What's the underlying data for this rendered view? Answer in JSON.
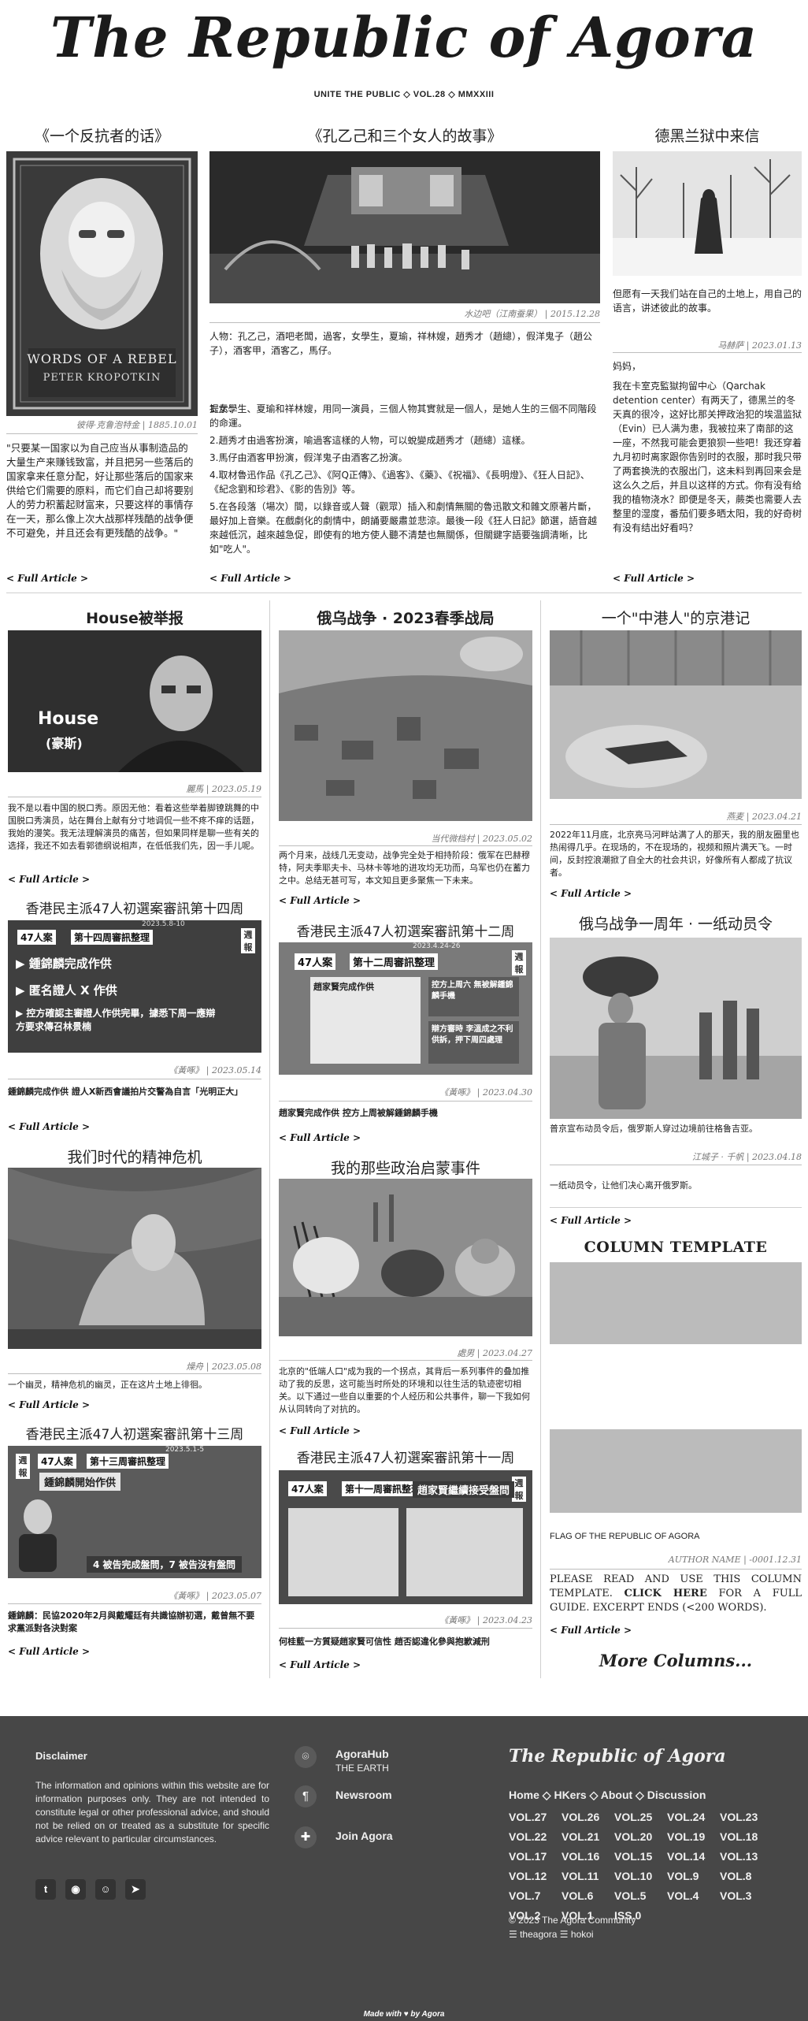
{
  "masthead": {
    "title": "The Republic of Agora",
    "subtitle": "UNITE THE PUBLIC ◇ VOL.28 ◇ MMXXIII"
  },
  "row1": {
    "a1": {
      "title": "《一个反抗者的话》",
      "book_words": "Words of a Rebel",
      "book_author": "Peter Kropotkin",
      "credit": "彼得·克鲁泡特金 | 1885.10.01",
      "text": "\"只要某一国家以为自己应当从事制造品的大量生产来赚钱致富，并且把另一些落后的国家拿来任意分配，好让那些落后的国家来供给它们需要的原料，而它们自己却将要别人的劳力积蓄起财富来，只要这样的事情存在一天，那么像上次大战那样残酷的战争便不可避免，并且还会有更残酷的战争。\"",
      "full": "< Full Article >"
    },
    "a2": {
      "title": "《孔乙己和三个女人的故事》",
      "credit": "水边吧（江南蚕果） | 2015.12.28",
      "intro": "人物：孔乙己，酒吧老闆，過客，女學生，夏瑜，祥林嫂，趙秀才（趙總），假洋鬼子（趙公子），酒客甲，酒客乙，馬仔。",
      "hint": "提示：",
      "items": [
        "1.女學生、夏瑜和祥林嫂，用同一演員，三個人物其實就是一個人，是她人生的三個不同階段的命運。",
        "2.趙秀才由過客扮演，喻過客這樣的人物，可以蛻變成趙秀才（趙總）這樣。",
        "3.馬仔由酒客甲扮演，假洋鬼子由酒客乙扮演。",
        "4.取材魯迅作品《孔乙己》、《阿Q正傳》、《過客》、《藥》、《祝福》、《長明燈》、《狂人日記》、《紀念劉和珍君》、《影的告別》等。",
        "5.在各段落（場次）間，以錄音或人聲（觀眾）插入和劇情無關的魯迅散文和雜文原著片斷，最好加上音樂。在戲劇化的劇情中，朗誦要嚴肅並悲涼。最後一段《狂人日記》節選，語音越來越低沉，越來越急促，即使有的地方使人聽不清楚也無關係，但關鍵字語要強調清晰，比如\"吃人\"。"
      ],
      "full": "< Full Article >"
    },
    "a3": {
      "title": "德黑兰狱中来信",
      "lead": "但愿有一天我们站在自己的土地上，用自己的语言，讲述彼此的故事。",
      "credit": "马赫萨 | 2023.01.13",
      "greeting": "妈妈，",
      "text": "我在卡室克監獄拘留中心（Qarchak detention center）有两天了，德黑兰的冬天真的很冷，这好比那关押政治犯的埃温监狱（Evin）已人满为患，我被拉来了南部的这一座，不然我可能会更狼狈一些吧！我还穿着九月初时离家跟你告别时的衣服，那时我只带了两套换洗的衣服出门，这未料到再回来会是这么久之后，并且以这样的方式。你有没有给我的植物浇水？即便是冬天，蕨类也需要人去整里的湿度，番茄们要多晒太阳，我的好奇树有没有结出好看吗？",
      "full": "< Full Article >"
    }
  },
  "rows": {
    "l1": {
      "title": "House被举报",
      "credit": "麗馬 | 2023.05.19",
      "text": "我不是以看中国的脱口秀。原因无他：看着这些举着脚镣跳舞的中国脱口秀演员，站在舞台上献有分寸地调侃一些不疼不痒的话题，我始的漫笑。我无法理解演员的痛苦，但如果同样是聊一些有关的选择，我还不如去看郭德纲说相声，在低低我们先，因一手儿呢。",
      "full": "< Full Article >",
      "img_caption": "House",
      "img_caption2": "(豪斯)"
    },
    "m1": {
      "title": "俄乌战争 · 2023春季战局",
      "credit": "当代微档村 | 2023.05.02",
      "text": "两个月来，战线几无变动，战争完全处于相持阶段：俄军在巴赫穆特，阿夫季耶夫卡、马林卡等地的进攻均无功而，乌军也仍在蓄力之中。总结无甚可写，本文知且更多聚焦一下未来。",
      "full": "< Full Article >"
    },
    "r1": {
      "title": "一个\"中港人\"的京港记",
      "credit": "燕麦 | 2023.04.21",
      "text": "2022年11月底，北京亮马河畔站满了人的那天，我的朋友圈里也热闹得几乎。在现场的，不在现场的，视频和照片满天飞。一时间，反封控浪潮掀了自全大的社会共识，好像所有人都成了抗议者。",
      "full": "< Full Article >"
    },
    "l2": {
      "title": "香港民主派47人初選案審訊第十四周",
      "credit": "《黃啄》 | 2023.05.14",
      "text": "鍾錦麟完成作供 證人X新西會議拍片交警為自言「光明正大」",
      "full": "< Full Article >",
      "card_case": "47人案",
      "card_week": "第十四周審訊整理",
      "card_date": "2023.5.8-10",
      "card_b1": "▶ 鍾錦麟完成作供",
      "card_b2": "▶ 匿名證人 X 作供",
      "card_b3": "▶ 控方確認主審證人作供完畢，據悉下周一應辯方要求傳召林景楠",
      "card_tag": "週報"
    },
    "m2": {
      "title": "香港民主派47人初選案審訊第十二周",
      "credit": "《黃啄》 | 2023.04.30",
      "text": "趙家賢完成作供 控方上周被解鍾錦麟手機",
      "full": "< Full Article >",
      "card_case": "47人案",
      "card_week": "第十二周審訊整理",
      "card_date": "2023.4.24-26",
      "card_box1": "趙家賢完成作供",
      "card_box2": "控方上周六 無被解鍾錦麟手機",
      "card_box3": "辯方審時 李溫成之不利供訴，押下周四處理",
      "card_tag": "週報"
    },
    "r2": {
      "title": "俄乌战争一周年 · 一纸动员令",
      "caption": "普京宣布动员令后，俄罗斯人穿过边境前往格鲁吉亚。",
      "credit": "江城子 · 千帆 | 2023.04.18",
      "text": "一纸动员令，让他们决心离开俄罗斯。",
      "full": "< Full Article >"
    },
    "l3": {
      "title": "我们时代的精神危机",
      "credit": "燥舟 | 2023.05.08",
      "text": "一个幽灵，精神危机的幽灵，正在这片土地上徘徊。",
      "full": "< Full Article >"
    },
    "m3": {
      "title": "我的那些政治启蒙事件",
      "credit": "處男 | 2023.04.27",
      "text": "北京的\"低端人口\"成为我的一个拐点，其背后一系列事件的叠加推动了我的反思，这可能当时所处的环境和以往生活的轨迹密切相关。以下通过一些自以重要的个人经历和公共事件，聊一下我如何从认同转向了对抗的。",
      "full": "< Full Article >"
    },
    "l4": {
      "title": "香港民主派47人初選案審訊第十三周",
      "credit": "《黃啄》 | 2023.05.07",
      "text": "鍾錦麟：民協2020年2月與戴耀廷有共識協辦初選，戴曾無不要求黨派對各決對案",
      "full": "< Full Article >",
      "card_case": "47人案",
      "card_week": "第十三周審訊整理",
      "card_date": "2023.5.1-5",
      "card_sub": "鍾錦麟開始作供",
      "card_foot": "4 被告完成盤問，7 被告沒有盤問",
      "card_tag": "週報"
    },
    "m4": {
      "title": "香港民主派47人初選案審訊第十一周",
      "credit": "《黃啄》 | 2023.04.23",
      "text": "何桂藍一方質疑趙家賢可信性 趙否認違化參與抱歉減刑",
      "full": "< Full Article >",
      "card_case": "47人案",
      "card_week": "第十一周審訊整理",
      "card_sub": "趙家賢繼續接受盤問",
      "card_tag": "週報"
    },
    "r3": {
      "title": "COLUMN TEMPLATE",
      "flag": "FLAG OF THE REPUBLIC OF AGORA",
      "credit": "AUTHOR NAME | -0001.12.31",
      "text1": "PLEASE READ AND USE THIS COLUMN TEMPLATE. ",
      "text2": "CLICK HERE",
      "text3": " FOR A FULL GUIDE. EXCERPT ENDS (<200 WORDS).",
      "full": "< Full Article >"
    },
    "more": "More Columns..."
  },
  "footer": {
    "disclaimer_title": "Disclaimer",
    "disclaimer_text": "The information and opinions within this website are for information purposes only. They are not intended to constitute legal or other professional advice, and should not be relied on or treated as a substitute for specific advice relevant to particular circumstances.",
    "social": [
      "twitter-icon",
      "github-icon",
      "reddit-icon",
      "telegram-icon"
    ],
    "links": [
      {
        "label": "AgoraHub",
        "sub": "THE EARTH",
        "icon": "location-icon"
      },
      {
        "label": "Newsroom",
        "sub": "",
        "icon": "paragraph-icon"
      },
      {
        "label": "Join Agora",
        "sub": "",
        "icon": "puzzle-icon"
      }
    ],
    "brand": "The Republic of Agora",
    "nav": [
      "Home",
      "HKers",
      "About",
      "Discussion"
    ],
    "vols": [
      "VOL.27",
      "VOL.26",
      "VOL.25",
      "VOL.24",
      "VOL.23",
      "VOL.22",
      "VOL.21",
      "VOL.20",
      "VOL.19",
      "VOL.18",
      "VOL.17",
      "VOL.16",
      "VOL.15",
      "VOL.14",
      "VOL.13",
      "VOL.12",
      "VOL.11",
      "VOL.10",
      "VOL.9",
      "VOL.8",
      "VOL.7",
      "VOL.6",
      "VOL.5",
      "VOL.4",
      "VOL.3",
      "VOL.2",
      "VOL.1",
      "ISS.0"
    ],
    "copyright": "© 2023 The Agora Community",
    "handles": "☰ theagora ☰ hokoi",
    "made": "Made with ♥ by Agora"
  },
  "colors": {
    "background": "#ffffff",
    "footer": "#474747",
    "rule": "#cfcfcf",
    "placeholder": "#bbbbbb"
  }
}
